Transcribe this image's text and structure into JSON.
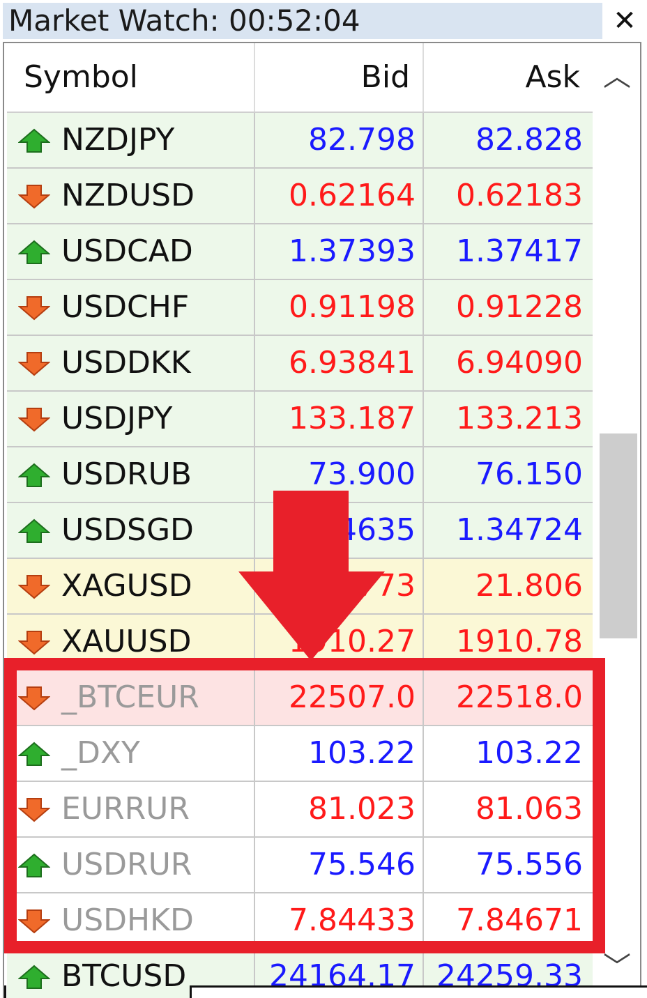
{
  "window": {
    "title": "Market Watch: 00:52:04",
    "close_glyph": "✕"
  },
  "columns": {
    "symbol": "Symbol",
    "bid": "Bid",
    "ask": "Ask"
  },
  "colors": {
    "up": "#1a1aff",
    "down": "#ff1a1a",
    "row_green": "#edf8ea",
    "row_yellow": "#fbf8d6",
    "row_pink": "#fde3e3",
    "row_white": "#ffffff",
    "symbol_active": "#111111",
    "symbol_inactive": "#9a9a9a",
    "highlight": "#e8202a"
  },
  "rows": [
    {
      "symbol": "NZDJPY",
      "bid": "82.798",
      "ask": "82.828",
      "direction": "up",
      "bg": "green",
      "dim": false
    },
    {
      "symbol": "NZDUSD",
      "bid": "0.62164",
      "ask": "0.62183",
      "direction": "down",
      "bg": "green",
      "dim": false
    },
    {
      "symbol": "USDCAD",
      "bid": "1.37393",
      "ask": "1.37417",
      "direction": "up",
      "bg": "green",
      "dim": false
    },
    {
      "symbol": "USDCHF",
      "bid": "0.91198",
      "ask": "0.91228",
      "direction": "down",
      "bg": "green",
      "dim": false
    },
    {
      "symbol": "USDDKK",
      "bid": "6.93841",
      "ask": "6.94090",
      "direction": "down",
      "bg": "green",
      "dim": false
    },
    {
      "symbol": "USDJPY",
      "bid": "133.187",
      "ask": "133.213",
      "direction": "down",
      "bg": "green",
      "dim": false
    },
    {
      "symbol": "USDRUB",
      "bid": "73.900",
      "ask": "76.150",
      "direction": "up",
      "bg": "green",
      "dim": false
    },
    {
      "symbol": "USDSGD",
      "bid": "1.34635",
      "ask": "1.34724",
      "direction": "up",
      "bg": "green",
      "dim": false
    },
    {
      "symbol": "XAGUSD",
      "bid": "21.773",
      "ask": "21.806",
      "direction": "down",
      "bg": "yellow",
      "dim": false
    },
    {
      "symbol": "XAUUSD",
      "bid": "1910.27",
      "ask": "1910.78",
      "direction": "down",
      "bg": "yellow",
      "dim": false
    },
    {
      "symbol": "_BTCEUR",
      "bid": "22507.0",
      "ask": "22518.0",
      "direction": "down",
      "bg": "pink",
      "dim": true
    },
    {
      "symbol": "_DXY",
      "bid": "103.22",
      "ask": "103.22",
      "direction": "up",
      "bg": "white",
      "dim": true
    },
    {
      "symbol": "EURRUR",
      "bid": "81.023",
      "ask": "81.063",
      "direction": "down",
      "bg": "white",
      "dim": true
    },
    {
      "symbol": "USDRUR",
      "bid": "75.546",
      "ask": "75.556",
      "direction": "up",
      "bg": "white",
      "dim": true
    },
    {
      "symbol": "USDHKD",
      "bid": "7.84433",
      "ask": "7.84671",
      "direction": "down",
      "bg": "white",
      "dim": true
    },
    {
      "symbol": "BTCUSD",
      "bid": "24164.17",
      "ask": "24259.33",
      "direction": "up",
      "bg": "green",
      "dim": false
    }
  ],
  "scrollbar": {
    "up_glyph": "︿",
    "down_glyph": "﹀"
  },
  "icons": {
    "up": "arrow-up-green-icon",
    "down": "arrow-down-red-icon",
    "annotation": "red-down-arrow-annotation"
  }
}
